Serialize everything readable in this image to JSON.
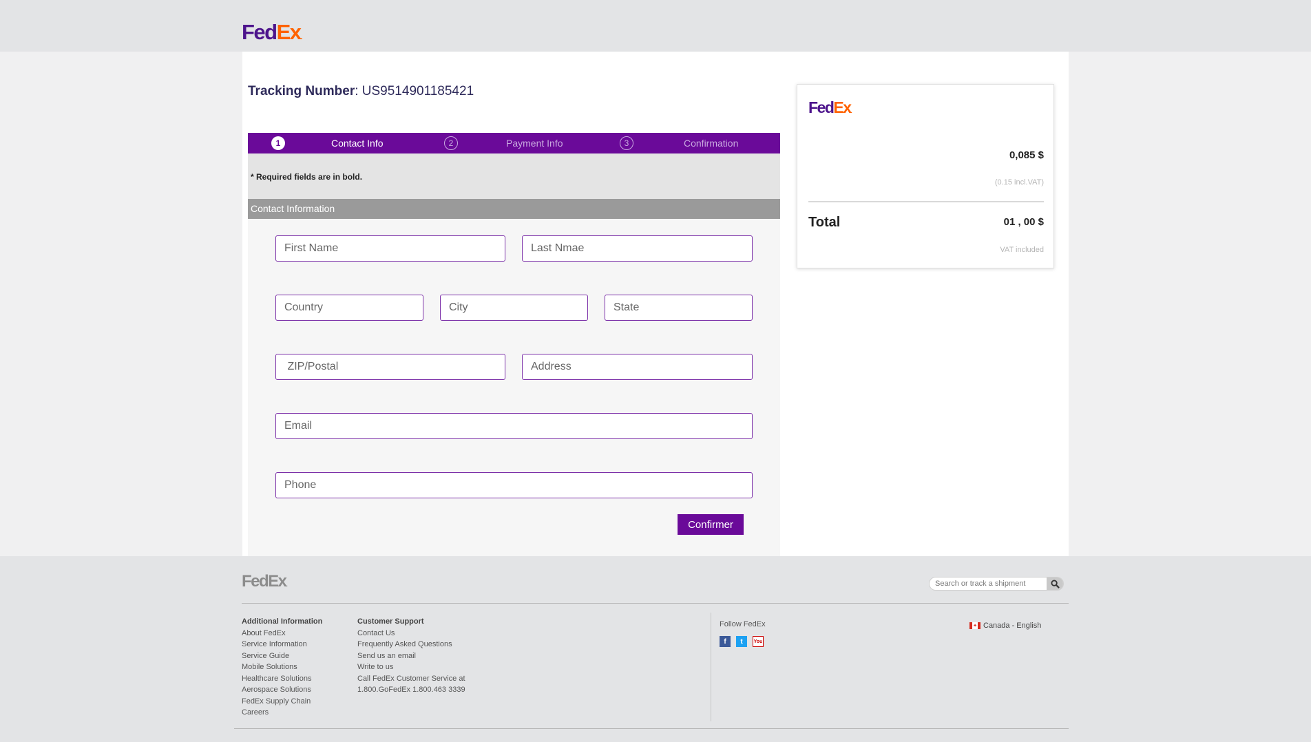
{
  "header": {
    "logo_fed": "Fed",
    "logo_ex": "Ex",
    "logo_dot": "."
  },
  "tracking": {
    "label": "Tracking Number",
    "separator": ": ",
    "number": "US9514901185421"
  },
  "steps": [
    {
      "num": "1",
      "label": "Contact Info",
      "state": "active"
    },
    {
      "num": "2",
      "label": "Payment Info",
      "state": "inactive"
    },
    {
      "num": "3",
      "label": "Confirmation",
      "state": "inactive"
    }
  ],
  "form": {
    "required_note": "* Required fields are in bold.",
    "section_title": "Contact Information",
    "fields": {
      "first_name": "First Name",
      "last_name": "Last Nmae",
      "country": "Country",
      "city": "City",
      "state": "State",
      "zip": " ZIP/Postal",
      "address": "Address",
      "email": "Email",
      "phone": "Phone"
    },
    "confirm_label": "Confirmer"
  },
  "summary": {
    "price": "0,085 $",
    "vat_note": "(0.15 incl.VAT)",
    "total_label": "Total",
    "total_value": "01 , 00 $",
    "vat_included": "VAT included"
  },
  "footer": {
    "search_placeholder": "Search or track a shipment",
    "col1": {
      "heading": "Additional Information",
      "links": [
        "About FedEx",
        "Service Information",
        "Service Guide",
        "Mobile Solutions",
        "Healthcare Solutions",
        "Aerospace Solutions",
        "FedEx Supply Chain",
        "Careers"
      ]
    },
    "col2": {
      "heading": "Customer Support",
      "links": [
        "Contact Us",
        "Frequently Asked Questions",
        "Send us an email",
        "Write to us",
        "Call FedEx Customer Service at",
        "1.800.GoFedEx 1.800.463 3339"
      ]
    },
    "follow": "Follow FedEx",
    "social": {
      "facebook": "f",
      "twitter": "t",
      "youtube": "You"
    },
    "locale": "Canada - English"
  },
  "colors": {
    "brand_purple": "#4d148c",
    "brand_orange": "#ff6200",
    "step_bar": "#6a0a99",
    "field_border": "#7b2fa8"
  }
}
